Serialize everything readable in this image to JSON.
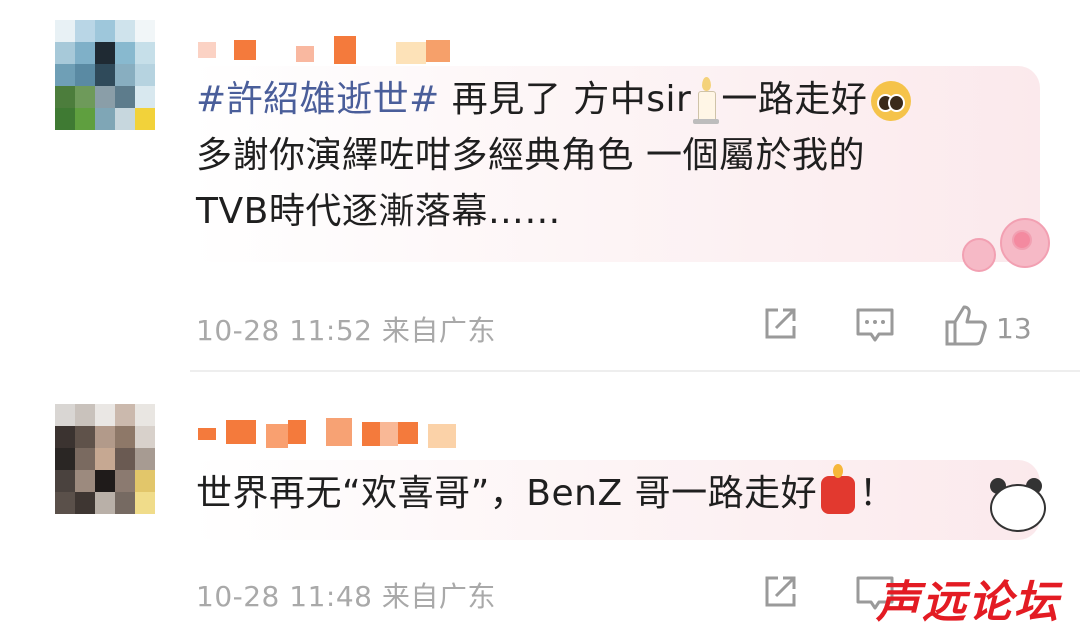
{
  "comments": [
    {
      "hashtag": "#許紹雄逝世#",
      "text_l1": "再見了 方中sir",
      "text_l1_end": "一路走好",
      "text_l2": "多謝你演繹咗咁多經典角色 一個屬於我的",
      "text_l3": "TVB時代逐漸落幕……",
      "time": "10-28 11:52",
      "location": "来自广东",
      "likes": "13"
    },
    {
      "text_l1": "世界再无“欢喜哥”，BenZ 哥一路走好",
      "text_l1_end": "！",
      "time": "10-28 11:48",
      "location": "来自广东"
    }
  ],
  "icons": {
    "share": "share-icon",
    "reply": "comment-icon",
    "like": "thumbs-up-icon",
    "candle": "candle-emoji",
    "pleading": "pleading-face-emoji",
    "red_candle": "red-candle-emoji"
  },
  "watermark": "声远论坛",
  "colors": {
    "hashtag": "#4a5e9a",
    "meta": "#a9a9a9",
    "watermark": "#e31b23"
  }
}
